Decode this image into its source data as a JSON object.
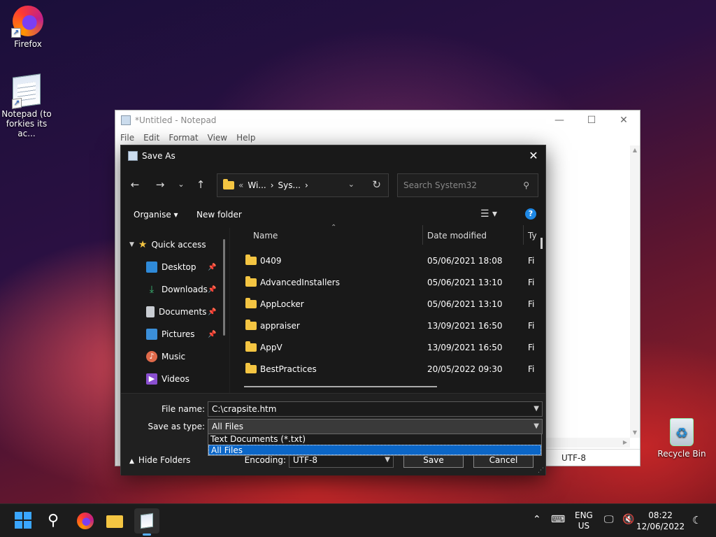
{
  "desktop": {
    "icons": [
      {
        "label": "Firefox"
      },
      {
        "label": "Notepad (to forkies its ac..."
      },
      {
        "label": "Recycle Bin"
      }
    ]
  },
  "notepad": {
    "title": "*Untitled - Notepad",
    "menu": [
      "File",
      "Edit",
      "Format",
      "View",
      "Help"
    ],
    "status_encoding": "UTF-8"
  },
  "saveas": {
    "title": "Save As",
    "address": {
      "crumbs": [
        "Wi...",
        "Sys..."
      ],
      "prefix": "«"
    },
    "search_placeholder": "Search System32",
    "organise": "Organise ▾",
    "new_folder": "New folder",
    "nav": {
      "quick_access": "Quick access",
      "items": [
        {
          "label": "Desktop",
          "pinned": true
        },
        {
          "label": "Downloads",
          "pinned": true
        },
        {
          "label": "Documents",
          "pinned": true
        },
        {
          "label": "Pictures",
          "pinned": true
        },
        {
          "label": "Music",
          "pinned": false
        },
        {
          "label": "Videos",
          "pinned": false
        }
      ]
    },
    "columns": {
      "name": "Name",
      "date": "Date modified",
      "type": "Ty"
    },
    "files": [
      {
        "name": "0409",
        "date": "05/06/2021 18:08",
        "type": "Fi"
      },
      {
        "name": "AdvancedInstallers",
        "date": "05/06/2021 13:10",
        "type": "Fi"
      },
      {
        "name": "AppLocker",
        "date": "05/06/2021 13:10",
        "type": "Fi"
      },
      {
        "name": "appraiser",
        "date": "13/09/2021 16:50",
        "type": "Fi"
      },
      {
        "name": "AppV",
        "date": "13/09/2021 16:50",
        "type": "Fi"
      },
      {
        "name": "BestPractices",
        "date": "20/05/2022 09:30",
        "type": "Fi"
      }
    ],
    "file_name_label": "File name:",
    "file_name_value": "C:\\crapsite.htm",
    "save_type_label": "Save as type:",
    "save_type_value": "All Files",
    "type_options": [
      "Text Documents (*.txt)",
      "All Files"
    ],
    "encoding_label": "Encoding:",
    "encoding_value": "UTF-8",
    "save_button": "Save",
    "cancel_button": "Cancel",
    "hide_folders": "Hide Folders"
  },
  "taskbar": {
    "lang_line1": "ENG",
    "lang_line2": "US",
    "time": "08:22",
    "date": "12/06/2022"
  },
  "colors": {
    "accent": "#0b66c7",
    "folder": "#f4c542"
  }
}
